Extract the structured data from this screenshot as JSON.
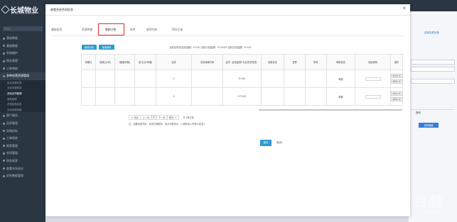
{
  "app": {
    "logo_text": "长城物业",
    "logo_sub": "CHANGCHENG PROPERTY",
    "search_placeholder": "请输入",
    "menu": [
      {
        "label": "基础数据",
        "type": "top"
      },
      {
        "label": "基础数据",
        "type": "top"
      },
      {
        "label": "系统维护",
        "type": "top"
      },
      {
        "label": "物业管理",
        "type": "top"
      },
      {
        "label": "订单审核",
        "type": "top"
      },
      {
        "label": "多种经营资源管理",
        "type": "top",
        "active": true
      },
      {
        "label": "综合资源列表",
        "type": "sub"
      },
      {
        "label": "多经资源登录",
        "type": "sub"
      },
      {
        "label": "多经合同管理",
        "type": "sub",
        "current": true
      },
      {
        "label": "收款管理",
        "type": "sub"
      },
      {
        "label": "资源结算结算",
        "type": "sub"
      },
      {
        "label": "多经收款明细",
        "type": "sub"
      },
      {
        "label": "客户服务",
        "type": "top"
      },
      {
        "label": "品质管理",
        "type": "top"
      },
      {
        "label": "采购招标",
        "type": "top"
      },
      {
        "label": "工单报修",
        "type": "top"
      },
      {
        "label": "报表管理",
        "type": "top"
      },
      {
        "label": "合同管理",
        "type": "top"
      },
      {
        "label": "财务报表",
        "type": "top"
      },
      {
        "label": "查看车场流水",
        "type": "top"
      },
      {
        "label": "综合数据管理",
        "type": "top"
      }
    ],
    "right_panel": {
      "link": "费用查看对象",
      "header": "操作",
      "button": "查看明细"
    }
  },
  "modal": {
    "title": "查看多经合同信息",
    "close_glyph": "×",
    "tabs": [
      {
        "label": "基础信息"
      },
      {
        "label": "资源明细"
      },
      {
        "label": "收款计划",
        "active": true
      },
      {
        "label": "附件"
      },
      {
        "label": "收到付款"
      },
      {
        "label": "拜访记录"
      }
    ],
    "toolbar": {
      "add_plan": "新增计划",
      "batch_add": "批量新增"
    },
    "summary": "当前合同总应收金额：¥ 0.00   当前计划金额：¥ 100.00   当前已收金额：¥ 0.00",
    "table": {
      "headers": [
        "到期日",
        "收款(元/年)",
        "租期(年期)",
        "实付(元/年期)",
        "实收",
        "实际收款时间",
        "合同（应收金额+为业务员完成）",
        "收款状态",
        "发票",
        "附件",
        "审核状态",
        "驳回说明",
        "操作"
      ],
      "rows": [
        {
          "cells": [
            "",
            "",
            "",
            "",
            "0",
            "",
            "¥ 0.00",
            "",
            "",
            "",
            "审核",
            "",
            ""
          ],
          "actions": [
            "修改计划",
            "删除计划"
          ]
        },
        {
          "cells": [
            "",
            "",
            "",
            "",
            "0",
            "",
            "¥ 70.00",
            "",
            "",
            "",
            "审核",
            "",
            ""
          ],
          "actions": [
            "修改计划",
            "删除计划"
          ]
        }
      ]
    },
    "pager": {
      "first": "<< 首页",
      "prev": "上一页",
      "current": "1",
      "next": "下一页",
      "last": "尾页 >>",
      "total": "共 2条记录"
    },
    "note": "注：如果还需开收，则来日期期年，保分年度拆分，以便较收入所需口径录入",
    "save": "保存",
    "cancel": "取消"
  },
  "watermark": {
    "main": "启航",
    "sub": "DTCMS.NET"
  }
}
